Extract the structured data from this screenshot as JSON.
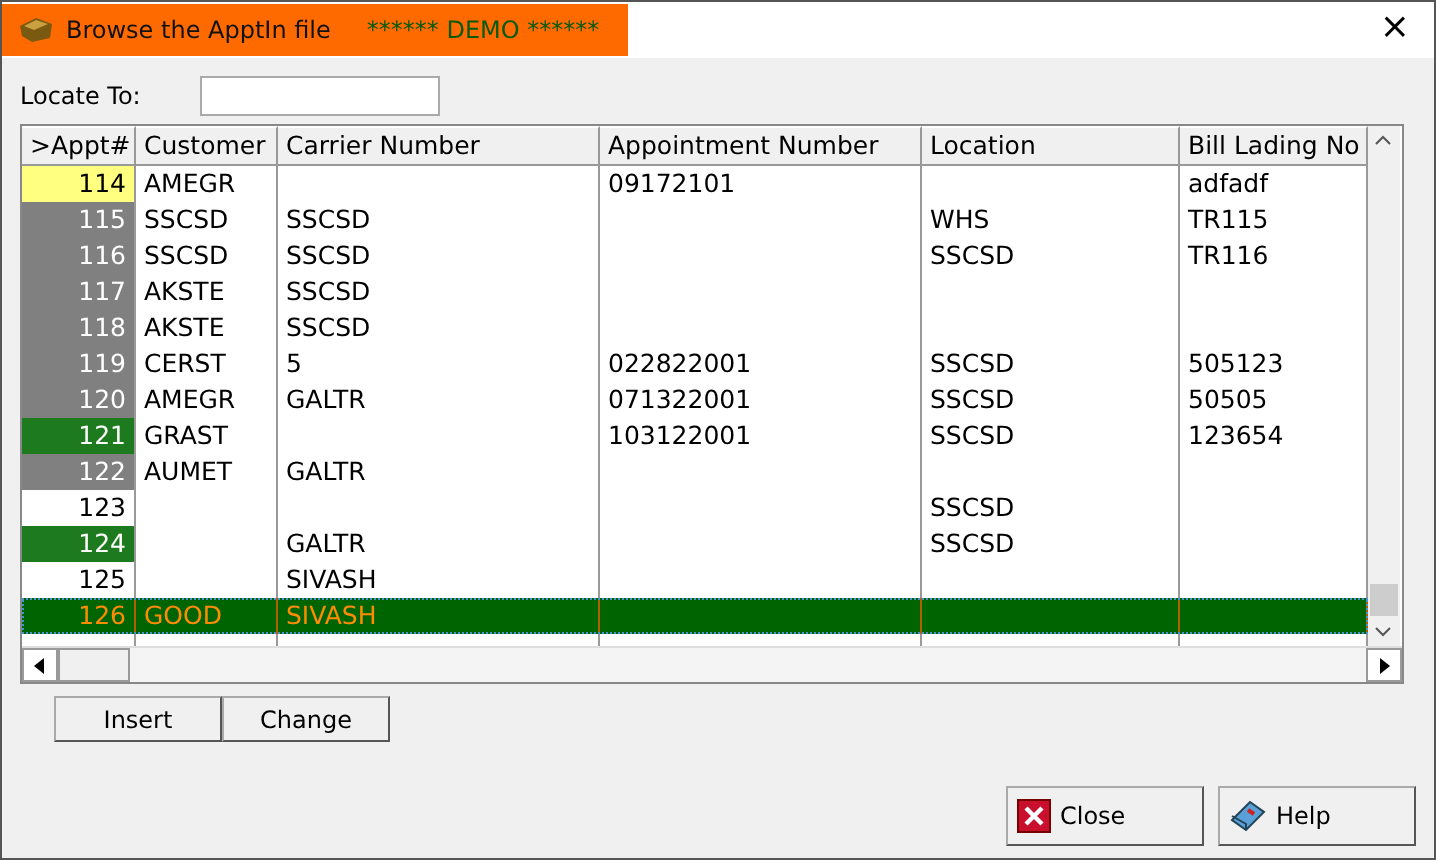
{
  "window": {
    "title": "Browse the ApptIn file",
    "badge": "****** DEMO ******",
    "close": "×"
  },
  "locate": {
    "label": "Locate To:"
  },
  "table": {
    "columns": [
      ">Appt#",
      "Customer",
      "Carrier Number",
      "Appointment Number",
      "Location",
      "Bill Lading No"
    ],
    "rows": [
      {
        "color": "#ffff80",
        "selected": false,
        "cells": [
          "114",
          "AMEGR",
          "",
          "09172101",
          "",
          "adfadf"
        ]
      },
      {
        "color": "#808080",
        "selected": false,
        "cells": [
          "115",
          "SSCSD",
          "SSCSD",
          "",
          "WHS",
          "TR115"
        ]
      },
      {
        "color": "#808080",
        "selected": false,
        "cells": [
          "116",
          "SSCSD",
          "SSCSD",
          "",
          "SSCSD",
          "TR116"
        ]
      },
      {
        "color": "#808080",
        "selected": false,
        "cells": [
          "117",
          "AKSTE",
          "SSCSD",
          "",
          "",
          ""
        ]
      },
      {
        "color": "#808080",
        "selected": false,
        "cells": [
          "118",
          "AKSTE",
          "SSCSD",
          "",
          "",
          ""
        ]
      },
      {
        "color": "#808080",
        "selected": false,
        "cells": [
          "119",
          "CERST",
          "5",
          "022822001",
          "SSCSD",
          "505123"
        ]
      },
      {
        "color": "#808080",
        "selected": false,
        "cells": [
          "120",
          "AMEGR",
          "GALTR",
          "071322001",
          "SSCSD",
          "50505"
        ]
      },
      {
        "color": "#1e7a1e",
        "selected": false,
        "cells": [
          "121",
          "GRAST",
          "",
          "103122001",
          "SSCSD",
          "123654"
        ]
      },
      {
        "color": "#808080",
        "selected": false,
        "cells": [
          "122",
          "AUMET",
          "GALTR",
          "",
          "",
          ""
        ]
      },
      {
        "color": "#ffffff",
        "selected": false,
        "cells": [
          "123",
          "",
          "",
          "",
          "SSCSD",
          ""
        ]
      },
      {
        "color": "#1e7a1e",
        "selected": false,
        "cells": [
          "124",
          "",
          "GALTR",
          "",
          "SSCSD",
          ""
        ]
      },
      {
        "color": "#ffffff",
        "selected": false,
        "cells": [
          "125",
          "",
          "SIVASH",
          "",
          "",
          ""
        ]
      },
      {
        "selected": true,
        "cells": [
          "126",
          "GOOD",
          "SIVASH",
          "",
          "",
          ""
        ]
      }
    ]
  },
  "buttons": [
    {
      "label": "Insert"
    },
    {
      "label": "Change"
    }
  ],
  "footer_buttons": [
    {
      "label": "Close",
      "kind": "close"
    },
    {
      "label": "Help",
      "kind": "help"
    }
  ]
}
